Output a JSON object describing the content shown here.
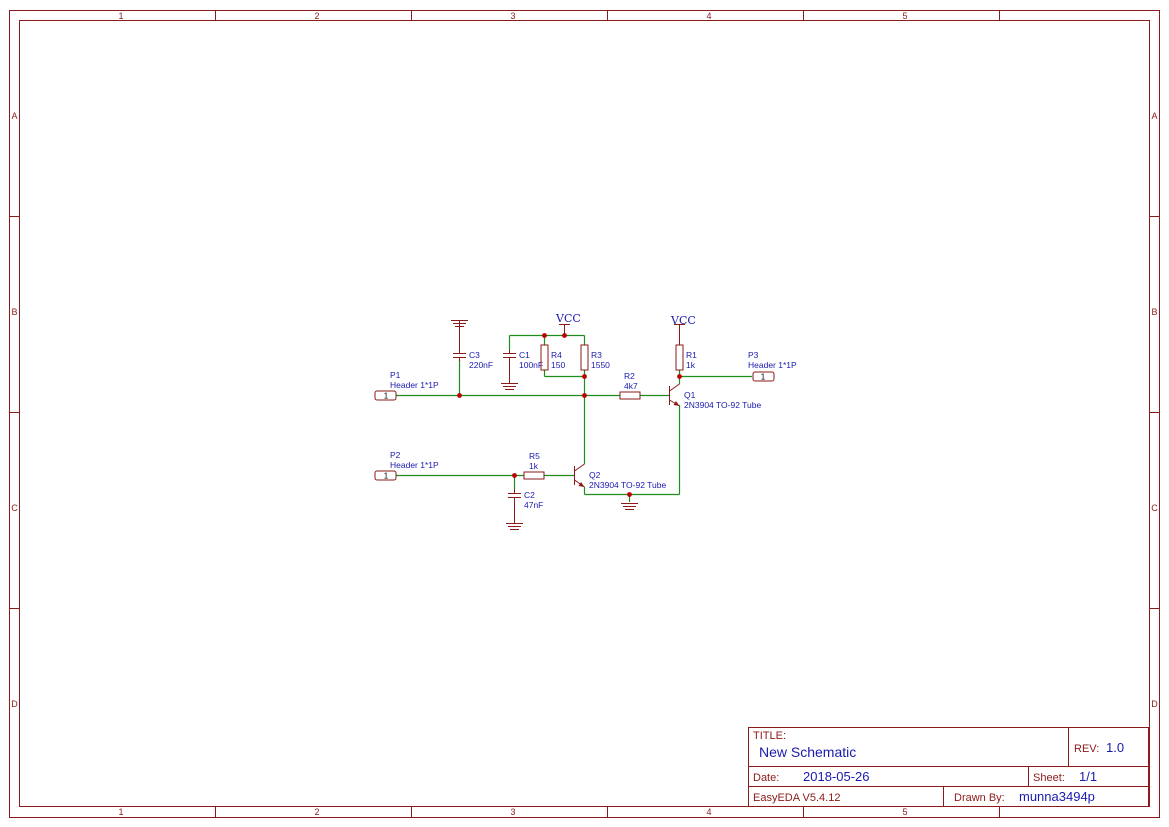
{
  "sheet": {
    "columns": [
      "1",
      "2",
      "3",
      "4",
      "5"
    ],
    "rows": [
      "A",
      "B",
      "C",
      "D"
    ]
  },
  "power": {
    "vcc_label": "VCC"
  },
  "components": {
    "p1": {
      "ref": "P1",
      "value": "Header 1*1P",
      "pin": "1"
    },
    "p2": {
      "ref": "P2",
      "value": "Header 1*1P",
      "pin": "1"
    },
    "p3": {
      "ref": "P3",
      "value": "Header 1*1P",
      "pin": "1"
    },
    "c1": {
      "ref": "C1",
      "value": "100nF"
    },
    "c2": {
      "ref": "C2",
      "value": "47nF"
    },
    "c3": {
      "ref": "C3",
      "value": "220nF"
    },
    "r1": {
      "ref": "R1",
      "value": "1k"
    },
    "r2": {
      "ref": "R2",
      "value": "4k7"
    },
    "r3": {
      "ref": "R3",
      "value": "1550"
    },
    "r4": {
      "ref": "R4",
      "value": "150"
    },
    "r5": {
      "ref": "R5",
      "value": "1k"
    },
    "q1": {
      "ref": "Q1",
      "value": "2N3904 TO-92 Tube"
    },
    "q2": {
      "ref": "Q2",
      "value": "2N3904 TO-92 Tube"
    }
  },
  "title_block": {
    "title_label": "TITLE:",
    "title_value": "New Schematic",
    "rev_label": "REV:",
    "rev_value": "1.0",
    "date_label": "Date:",
    "date_value": "2018-05-26",
    "sheet_label": "Sheet:",
    "sheet_value": "1/1",
    "software": "EasyEDA V5.4.12",
    "drawn_label": "Drawn By:",
    "drawn_value": "munna3494p"
  }
}
